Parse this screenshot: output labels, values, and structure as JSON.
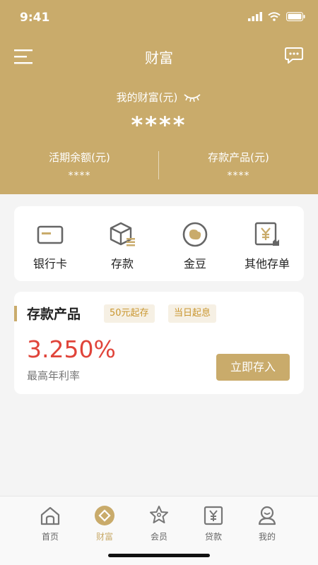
{
  "status": {
    "time": "9:41"
  },
  "navbar": {
    "title": "财富"
  },
  "wealth": {
    "label": "我的财富(元)",
    "value": "****"
  },
  "summary": [
    {
      "label": "活期余额(元)",
      "value": "****"
    },
    {
      "label": "存款产品(元)",
      "value": "****"
    }
  ],
  "quick_actions": [
    {
      "label": "银行卡",
      "icon": "bank-card-icon"
    },
    {
      "label": "存款",
      "icon": "deposit-box-icon"
    },
    {
      "label": "金豆",
      "icon": "gold-bean-icon"
    },
    {
      "label": "其他存单",
      "icon": "certificate-icon"
    }
  ],
  "product": {
    "title": "存款产品",
    "tags": [
      "50元起存",
      "当日起息"
    ],
    "rate": "3.250%",
    "rate_label": "最高年利率",
    "button": "立即存入"
  },
  "tabbar": {
    "items": [
      {
        "label": "首页",
        "icon": "home-icon",
        "active": false
      },
      {
        "label": "财富",
        "icon": "wealth-icon",
        "active": true
      },
      {
        "label": "会员",
        "icon": "member-icon",
        "active": false
      },
      {
        "label": "贷款",
        "icon": "loan-icon",
        "active": false
      },
      {
        "label": "我的",
        "icon": "profile-icon",
        "active": false
      }
    ]
  },
  "colors": {
    "brand": "#c9ab6b",
    "rate": "#e0443a",
    "tag_text": "#c9962f",
    "tag_bg": "#f6f0e4"
  }
}
